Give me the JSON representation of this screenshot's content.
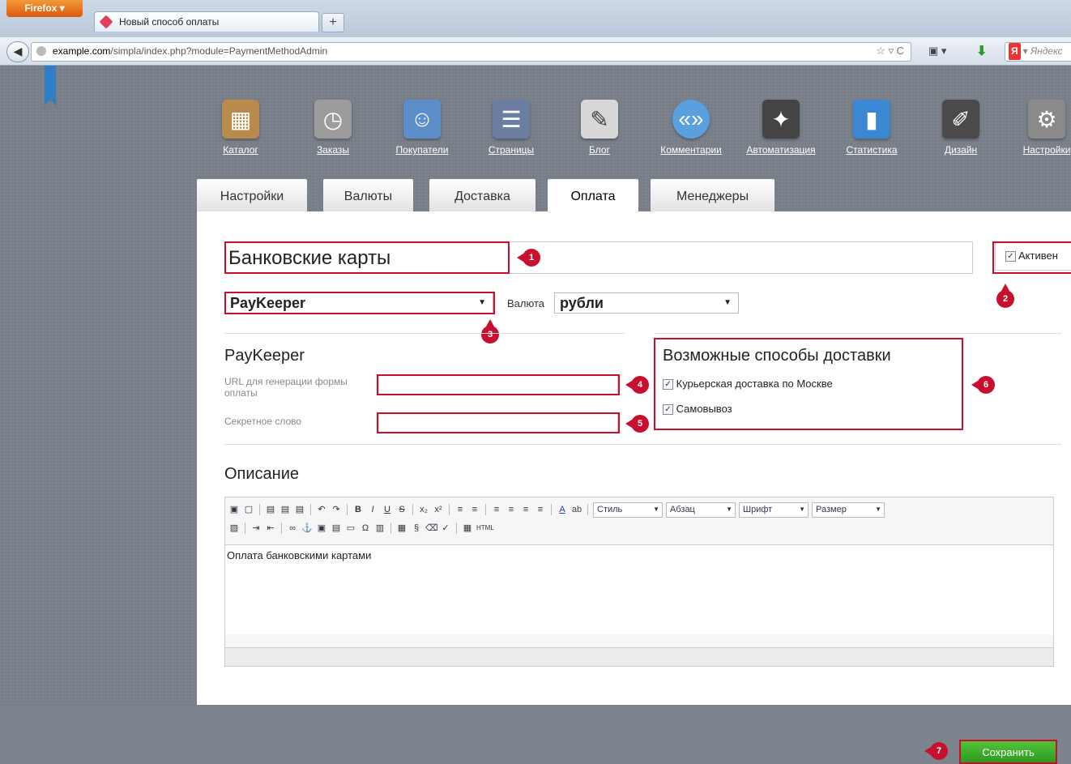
{
  "browser": {
    "menu_button": "Firefox",
    "tab_title": "Новый способ оплаты",
    "new_tab": "+",
    "url_host": "example.com",
    "url_path": "/simpla/index.php?module=PaymentMethodAdmin",
    "search_placeholder": "Яндекс"
  },
  "menu": [
    {
      "label": "Каталог",
      "icon": "catalog-icon",
      "color": "#b88a4b"
    },
    {
      "label": "Заказы",
      "icon": "orders-icon",
      "color": "#9c9c9c"
    },
    {
      "label": "Покупатели",
      "icon": "users-icon",
      "color": "#5c8fc9"
    },
    {
      "label": "Страницы",
      "icon": "pages-icon",
      "color": "#6b7ea1"
    },
    {
      "label": "Блог",
      "icon": "blog-icon",
      "color": "#d7d7d7"
    },
    {
      "label": "Комментарии",
      "icon": "comments-icon",
      "color": "#5aa0de"
    },
    {
      "label": "Автоматизация",
      "icon": "magic-wand-icon",
      "color": "#444444"
    },
    {
      "label": "Статистика",
      "icon": "stats-icon",
      "color": "#3a88d4"
    },
    {
      "label": "Дизайн",
      "icon": "design-icon",
      "color": "#4a4a4a"
    },
    {
      "label": "Настройки",
      "icon": "settings-icon",
      "color": "#8a8a8a"
    }
  ],
  "tabs": [
    "Настройки",
    "Валюты",
    "Доставка",
    "Оплата",
    "Менеджеры"
  ],
  "form": {
    "name_value": "Банковские карты",
    "active_label": "Активен",
    "active_checked": "✓",
    "module_value": "PayKeeper",
    "currency_label": "Валюта",
    "currency_value": "рубли",
    "module_title": "PayKeeper",
    "url_label": "URL для генерации формы оплаты",
    "url_value": "",
    "secret_label": "Секретное слово",
    "secret_value": "",
    "delivery_title": "Возможные способы доставки",
    "delivery_items": [
      "Курьерская доставка по Москве",
      "Самовывоз"
    ],
    "description_title": "Описание",
    "description_text": "Оплата банковскими картами",
    "save_label": "Сохранить"
  },
  "editor_toolbar": {
    "style_label": "Стиль",
    "format_label": "Абзац",
    "font_label": "Шрифт",
    "size_label": "Размер",
    "html_label": "HTML"
  },
  "annotations": [
    "1",
    "2",
    "3",
    "4",
    "5",
    "6",
    "7"
  ],
  "colors": {
    "accent_red": "#c8102e",
    "save_green": "#3aad27"
  }
}
